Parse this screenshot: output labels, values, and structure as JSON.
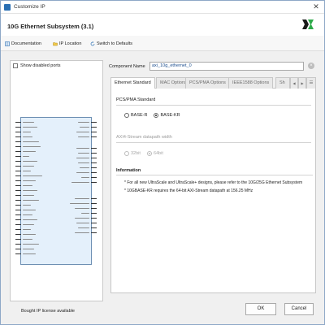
{
  "window": {
    "title": "Customize IP",
    "close_glyph": "✕"
  },
  "header": {
    "ip_name": "10G Ethernet Subsystem (3.1)",
    "logo": "xilinx-logo-icon"
  },
  "toolbar": {
    "documentation": "Documentation",
    "ip_location": "IP Location",
    "switch_to_defaults": "Switch to Defaults"
  },
  "left_pane": {
    "show_disabled_ports": "Show disabled ports",
    "show_disabled_ports_checked": false,
    "symbol": {
      "left_port_count": 28,
      "right_port_count": 20
    }
  },
  "component_name": {
    "label": "Component Name",
    "value": "axi_10g_ethernet_0",
    "clear_glyph": "×"
  },
  "tabs": [
    {
      "label": "Ethernet Standard",
      "active": true
    },
    {
      "label": "MAC Options",
      "active": false
    },
    {
      "label": "PCS/PMA Options",
      "active": false
    },
    {
      "label": "IEEE1588 Options",
      "active": false
    },
    {
      "label": "Sh",
      "active": false
    }
  ],
  "tab_nav": {
    "prev": "◀",
    "next": "▶",
    "menu": "☰"
  },
  "ethernet_standard": {
    "pcs_pma_title": "PCS/PMA Standard",
    "pcs_pma_options": [
      {
        "label": "BASE-R",
        "checked": false,
        "disabled": false
      },
      {
        "label": "BASE-KR",
        "checked": true,
        "disabled": false
      }
    ],
    "axi_title": "AXI4-Stream datapath width",
    "axi_options": [
      {
        "label": "32bit",
        "checked": false,
        "disabled": true
      },
      {
        "label": "64bit",
        "checked": true,
        "disabled": true
      }
    ],
    "info_title": "Information",
    "info_lines": [
      "* For all new UltraScale and UltraScale+ designs, please refer to the 10G/25G Ethernet Subsystem",
      "* 10GBASE-KR requires the 64-bit AXI-Stream datapath at 156.25 MHz"
    ]
  },
  "footer": {
    "license_status": "Bought IP license available",
    "ok": "OK",
    "cancel": "Cancel"
  }
}
